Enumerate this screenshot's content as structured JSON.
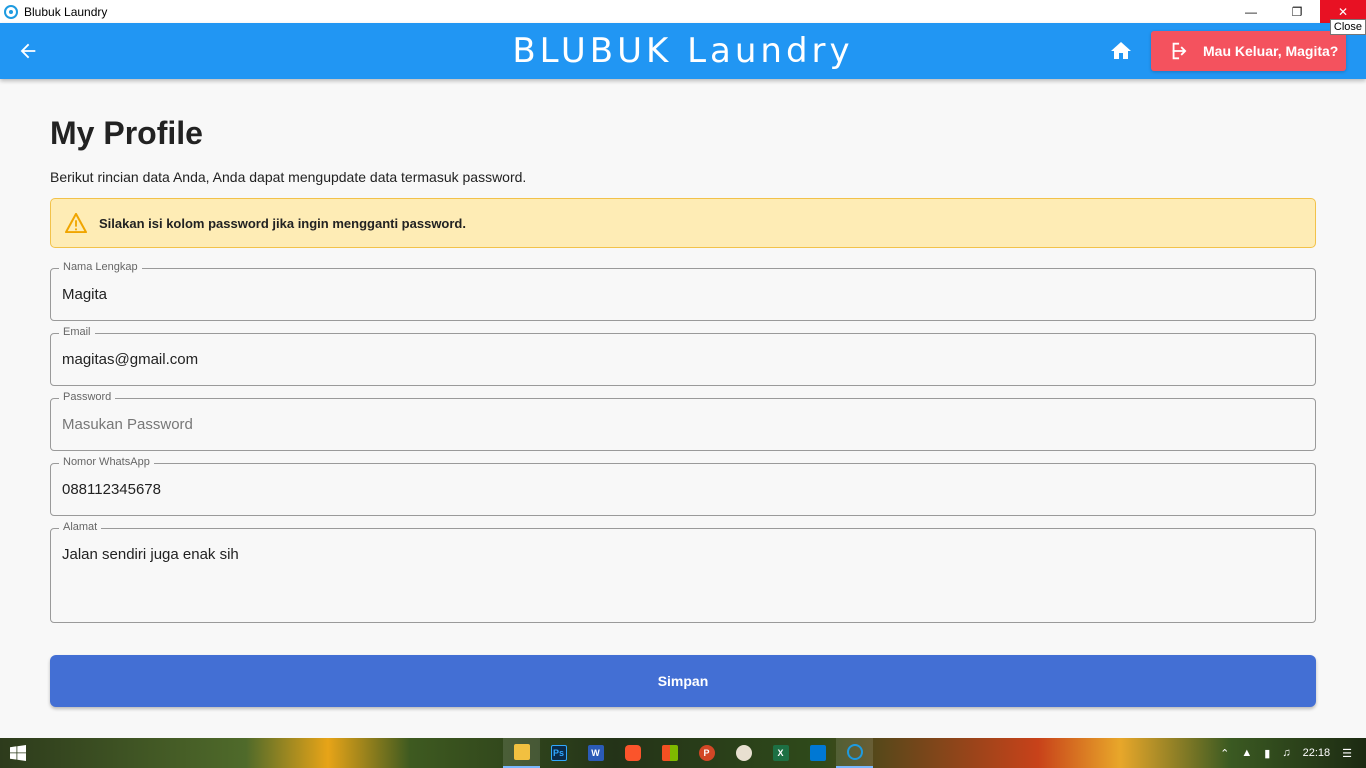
{
  "window": {
    "title": "Blubuk Laundry",
    "close_tooltip": "Close"
  },
  "appbar": {
    "brand": "BLUBUK Laundry",
    "logout_label": "Mau Keluar, Magita?",
    "color": "#2196f3",
    "logout_color": "#f4525e"
  },
  "page": {
    "title": "My Profile",
    "description": "Berikut rincian data Anda, Anda dapat mengupdate data termasuk password.",
    "alert": "Silakan isi kolom password jika ingin mengganti password."
  },
  "form": {
    "name": {
      "label": "Nama Lengkap",
      "value": "Magita"
    },
    "email": {
      "label": "Email",
      "value": "magitas@gmail.com"
    },
    "password": {
      "label": "Password",
      "value": "",
      "placeholder": "Masukan Password"
    },
    "whatsapp": {
      "label": "Nomor WhatsApp",
      "value": "088112345678"
    },
    "address": {
      "label": "Alamat",
      "value": "Jalan sendiri juga enak sih"
    },
    "submit_label": "Simpan",
    "submit_color": "#436fd4"
  },
  "taskbar": {
    "apps": [
      "file-explorer",
      "photoshop",
      "word",
      "brave",
      "store",
      "powerpoint",
      "paint",
      "excel",
      "vscode",
      "blubuk-laundry"
    ],
    "apps_labels": [
      "",
      "Ps",
      "W",
      "",
      "",
      "P",
      "",
      "X",
      "",
      ""
    ],
    "time": "22:18"
  }
}
